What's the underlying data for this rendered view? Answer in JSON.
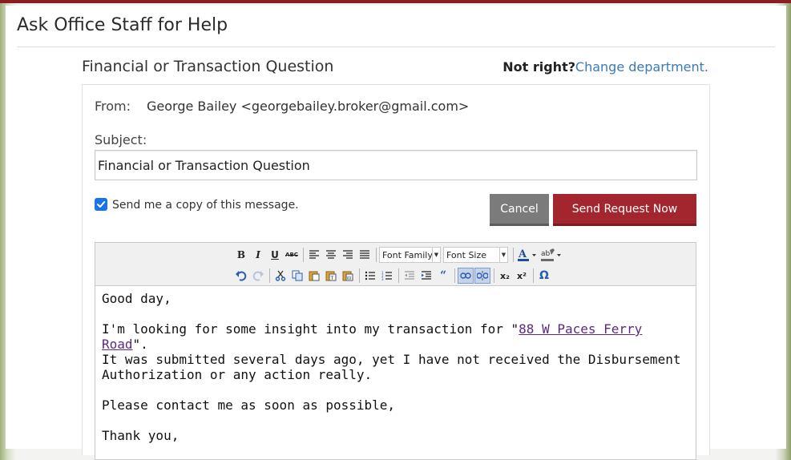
{
  "modal": {
    "title": "Ask Office Staff for Help"
  },
  "department": {
    "name": "Financial or Transaction Question",
    "not_right_label": "Not right?",
    "change_link": "Change department."
  },
  "form": {
    "from_label": "From:",
    "from_value": "George Bailey <georgebailey.broker@gmail.com>",
    "subject_label": "Subject:",
    "subject_value": "Financial or Transaction Question",
    "copy_checkbox_checked": true,
    "copy_label": "Send me a copy of this message.",
    "cancel_label": "Cancel",
    "send_label": "Send Request Now"
  },
  "toolbar": {
    "bold": "B",
    "italic": "I",
    "underline": "U",
    "strikethrough": "ABC",
    "font_family": "Font Family",
    "font_size": "Font Size",
    "subscript": "x₂",
    "superscript": "x²",
    "special_char": "Ω"
  },
  "editor": {
    "greeting": "Good day,",
    "line1_pre": "I'm looking for some insight into my transaction for \"",
    "link_text": "88 W Paces Ferry Road",
    "line1_post": "\".",
    "line2": "It was submitted several days ago, yet I have not received the Disbursement",
    "line3": "Authorization or any action really.",
    "line4": "Please contact me as soon as possible,",
    "line5": "Thank you,"
  },
  "colors": {
    "accent_red": "#a3262e",
    "link_blue": "#3a7ab7",
    "checkbox_blue": "#1a73e8",
    "cancel_gray": "#7b7b7b"
  }
}
